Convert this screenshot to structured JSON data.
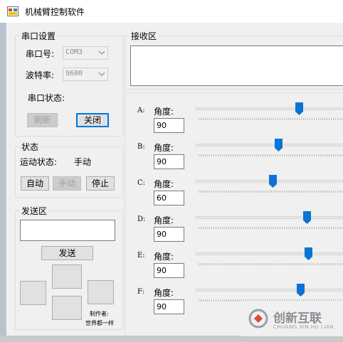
{
  "window": {
    "title": "机械臂控制软件"
  },
  "serial": {
    "legend": "串口设置",
    "port_label": "串口号:",
    "port_value": "COM3",
    "baud_label": "波特率:",
    "baud_value": "9600",
    "status_label": "串口状态:",
    "refresh_button": "刷新",
    "close_button": "关闭"
  },
  "state": {
    "legend": "状态",
    "motion_label": "运动状态:",
    "motion_value": "手动",
    "auto_button": "自动",
    "manual_button": "手动",
    "stop_button": "停止"
  },
  "send": {
    "legend": "发送区",
    "input_value": "",
    "send_button": "发送",
    "credit_line1": "制作者:",
    "credit_line2": "世界都一样"
  },
  "receive": {
    "legend": "接收区",
    "content": ""
  },
  "joints": [
    {
      "letter": "A:",
      "angle_label": "角度:",
      "value": "90",
      "slider_fraction": 0.7
    },
    {
      "letter": "B:",
      "angle_label": "角度:",
      "value": "90",
      "slider_fraction": 0.56
    },
    {
      "letter": "C:",
      "angle_label": "角度:",
      "value": "60",
      "slider_fraction": 0.52
    },
    {
      "letter": "D:",
      "angle_label": "角度:",
      "value": "90",
      "slider_fraction": 0.75
    },
    {
      "letter": "E:",
      "angle_label": "角度:",
      "value": "90",
      "slider_fraction": 0.76
    },
    {
      "letter": "F:",
      "angle_label": "角度:",
      "value": "90",
      "slider_fraction": 0.71
    }
  ],
  "watermark": {
    "text": "创新互联",
    "subtext": "CHUANG XIN HU LIAN"
  },
  "colors": {
    "accent": "#0078d7",
    "thumb": "#0a74d4",
    "watermark": "#9aa0a6"
  }
}
